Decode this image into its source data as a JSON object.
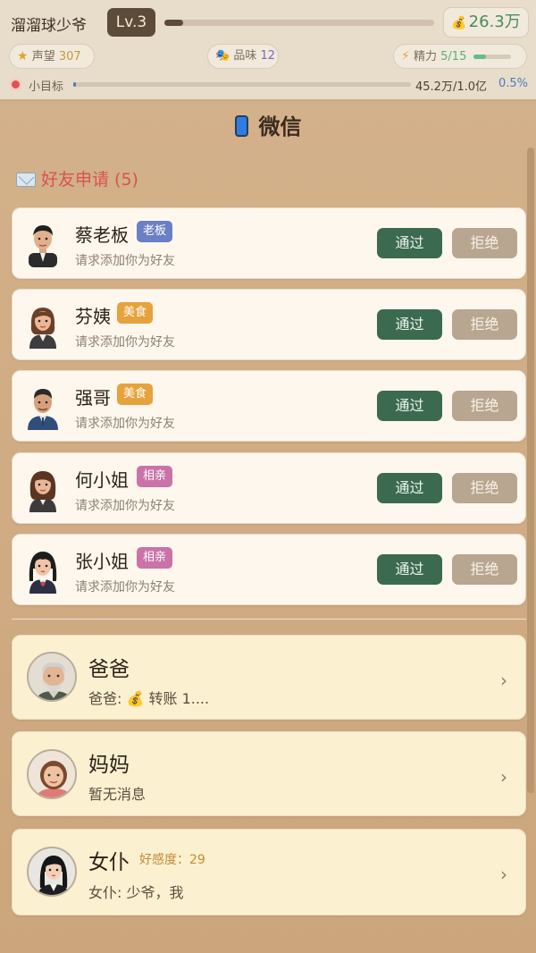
{
  "topbar": {
    "player_name": "溜溜球少爷",
    "level": "Lv.3",
    "xp_fraction": 0.07,
    "money": "26.3万",
    "money_icon": "money-bag-icon",
    "reputation_label": "声望",
    "reputation_value": "307",
    "taste_label": "品味",
    "taste_value": "12",
    "energy_label": "精力",
    "energy_value": "5/15",
    "energy_fraction": 0.333,
    "goal_label": "小目标",
    "goal_amount": "45.2万/1.0亿",
    "goal_pct": "0.5%",
    "goal_fraction": 0.005
  },
  "title": "微信",
  "requests": {
    "header": "好友申请 (5)",
    "accept_label": "通过",
    "reject_label": "拒绝",
    "items": [
      {
        "name": "蔡老板",
        "tag": "老板",
        "tag_color": "#6b7fc4",
        "subtitle": "请求添加你为好友"
      },
      {
        "name": "芬姨",
        "tag": "美食",
        "tag_color": "#e6a23c",
        "subtitle": "请求添加你为好友"
      },
      {
        "name": "强哥",
        "tag": "美食",
        "tag_color": "#e6a23c",
        "subtitle": "请求添加你为好友"
      },
      {
        "name": "何小姐",
        "tag": "相亲",
        "tag_color": "#c973a8",
        "subtitle": "请求添加你为好友"
      },
      {
        "name": "张小姐",
        "tag": "相亲",
        "tag_color": "#c973a8",
        "subtitle": "请求添加你为好友"
      }
    ]
  },
  "chats": [
    {
      "name": "爸爸",
      "message": "爸爸: 💰 转账 1....",
      "favor": ""
    },
    {
      "name": "妈妈",
      "message": "暂无消息",
      "favor": ""
    },
    {
      "name": "女仆",
      "message": "女仆: 少爷，我",
      "favor": "好感度：29"
    }
  ]
}
